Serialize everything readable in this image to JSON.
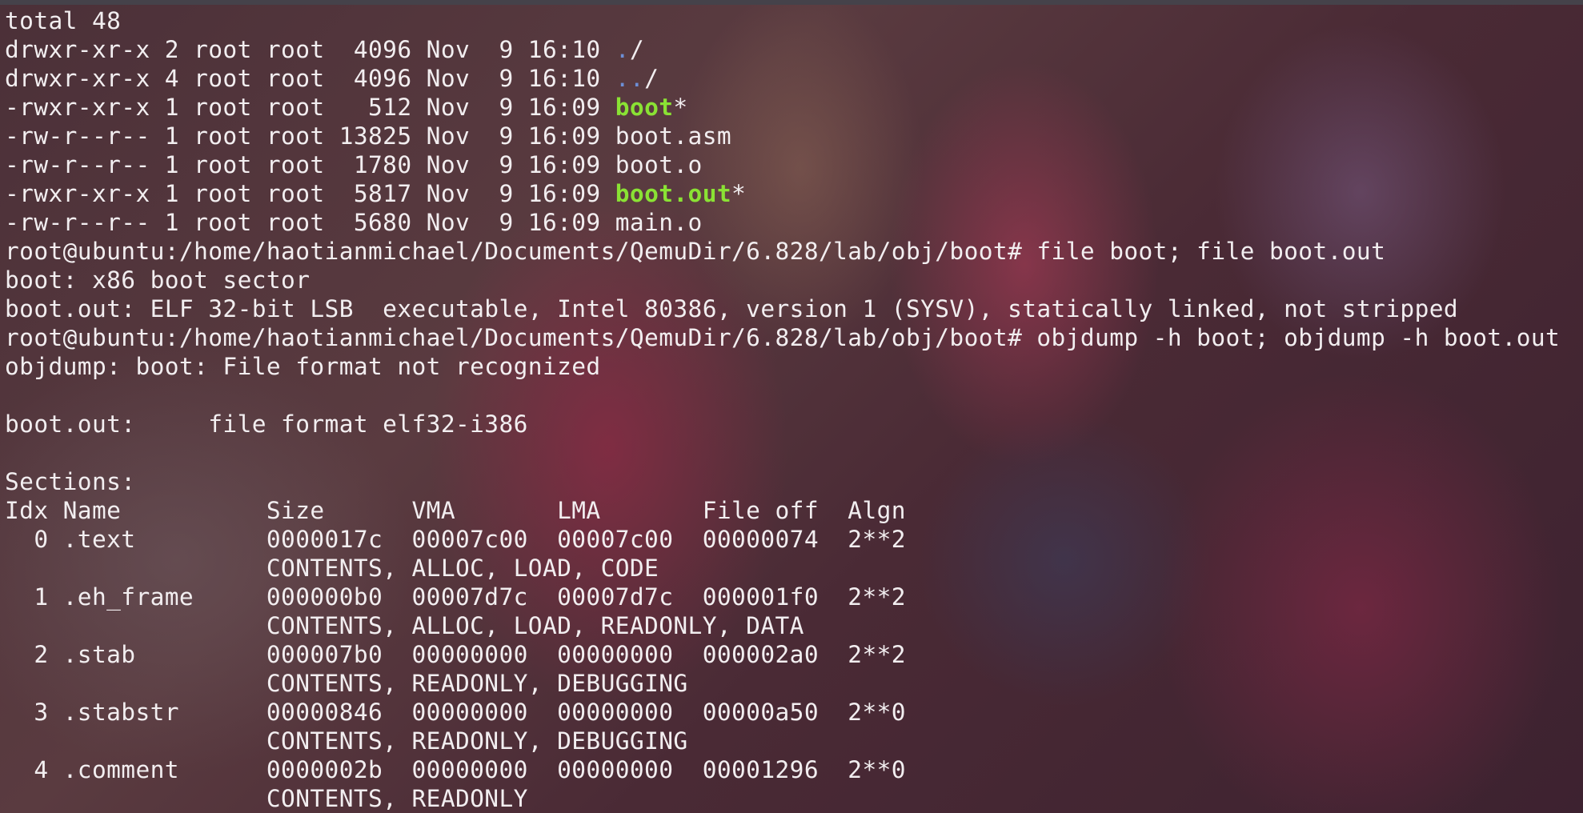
{
  "terminal": {
    "colors": {
      "foreground": "#f2eef0",
      "directory": "#6d8fd6",
      "executable": "#8ae234"
    },
    "lines": [
      {
        "segments": [
          {
            "text": "total 48",
            "style": "plain"
          }
        ]
      },
      {
        "segments": [
          {
            "text": "drwxr-xr-x 2 root root  4096 Nov  9 16:10 ",
            "style": "plain"
          },
          {
            "text": ".",
            "style": "dir"
          },
          {
            "text": "/",
            "style": "plain"
          }
        ]
      },
      {
        "segments": [
          {
            "text": "drwxr-xr-x 4 root root  4096 Nov  9 16:10 ",
            "style": "plain"
          },
          {
            "text": "..",
            "style": "dir"
          },
          {
            "text": "/",
            "style": "plain"
          }
        ]
      },
      {
        "segments": [
          {
            "text": "-rwxr-xr-x 1 root root   512 Nov  9 16:09 ",
            "style": "plain"
          },
          {
            "text": "boot",
            "style": "exec"
          },
          {
            "text": "*",
            "style": "plain"
          }
        ]
      },
      {
        "segments": [
          {
            "text": "-rw-r--r-- 1 root root 13825 Nov  9 16:09 boot.asm",
            "style": "plain"
          }
        ]
      },
      {
        "segments": [
          {
            "text": "-rw-r--r-- 1 root root  1780 Nov  9 16:09 boot.o",
            "style": "plain"
          }
        ]
      },
      {
        "segments": [
          {
            "text": "-rwxr-xr-x 1 root root  5817 Nov  9 16:09 ",
            "style": "plain"
          },
          {
            "text": "boot.out",
            "style": "exec"
          },
          {
            "text": "*",
            "style": "plain"
          }
        ]
      },
      {
        "segments": [
          {
            "text": "-rw-r--r-- 1 root root  5680 Nov  9 16:09 main.o",
            "style": "plain"
          }
        ]
      },
      {
        "segments": [
          {
            "text": "root@ubuntu:/home/haotianmichael/Documents/QemuDir/6.828/lab/obj/boot# file boot; file boot.out",
            "style": "plain"
          }
        ]
      },
      {
        "segments": [
          {
            "text": "boot: x86 boot sector",
            "style": "plain"
          }
        ]
      },
      {
        "segments": [
          {
            "text": "boot.out: ELF 32-bit LSB  executable, Intel 80386, version 1 (SYSV), statically linked, not stripped",
            "style": "plain"
          }
        ]
      },
      {
        "segments": [
          {
            "text": "root@ubuntu:/home/haotianmichael/Documents/QemuDir/6.828/lab/obj/boot# objdump -h boot; objdump -h boot.out",
            "style": "plain"
          }
        ]
      },
      {
        "segments": [
          {
            "text": "objdump: boot: File format not recognized",
            "style": "plain"
          }
        ]
      },
      {
        "segments": [
          {
            "text": "",
            "style": "plain"
          }
        ]
      },
      {
        "segments": [
          {
            "text": "boot.out:     file format elf32-i386",
            "style": "plain"
          }
        ]
      },
      {
        "segments": [
          {
            "text": "",
            "style": "plain"
          }
        ]
      },
      {
        "segments": [
          {
            "text": "Sections:",
            "style": "plain"
          }
        ]
      },
      {
        "segments": [
          {
            "text": "Idx Name          Size      VMA       LMA       File off  Algn",
            "style": "plain"
          }
        ]
      },
      {
        "segments": [
          {
            "text": "  0 .text         0000017c  00007c00  00007c00  00000074  2**2",
            "style": "plain"
          }
        ]
      },
      {
        "segments": [
          {
            "text": "                  CONTENTS, ALLOC, LOAD, CODE",
            "style": "plain"
          }
        ]
      },
      {
        "segments": [
          {
            "text": "  1 .eh_frame     000000b0  00007d7c  00007d7c  000001f0  2**2",
            "style": "plain"
          }
        ]
      },
      {
        "segments": [
          {
            "text": "                  CONTENTS, ALLOC, LOAD, READONLY, DATA",
            "style": "plain"
          }
        ]
      },
      {
        "segments": [
          {
            "text": "  2 .stab         000007b0  00000000  00000000  000002a0  2**2",
            "style": "plain"
          }
        ]
      },
      {
        "segments": [
          {
            "text": "                  CONTENTS, READONLY, DEBUGGING",
            "style": "plain"
          }
        ]
      },
      {
        "segments": [
          {
            "text": "  3 .stabstr      00000846  00000000  00000000  00000a50  2**0",
            "style": "plain"
          }
        ]
      },
      {
        "segments": [
          {
            "text": "                  CONTENTS, READONLY, DEBUGGING",
            "style": "plain"
          }
        ]
      },
      {
        "segments": [
          {
            "text": "  4 .comment      0000002b  00000000  00000000  00001296  2**0",
            "style": "plain"
          }
        ]
      },
      {
        "segments": [
          {
            "text": "                  CONTENTS, READONLY",
            "style": "plain"
          }
        ]
      }
    ]
  }
}
